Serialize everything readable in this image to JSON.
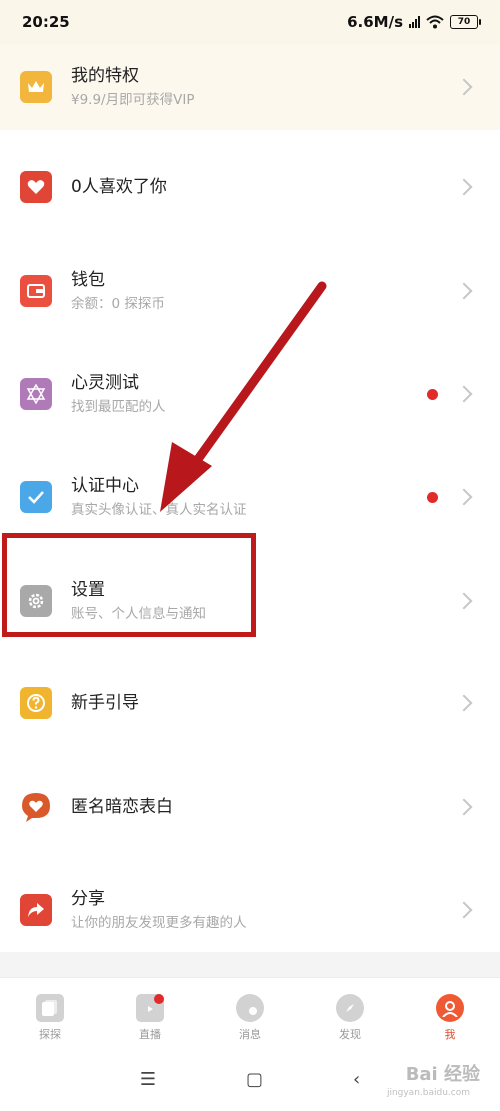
{
  "status_bar": {
    "time": "20:25",
    "speed": "6.6M/s",
    "battery": "70"
  },
  "menu": {
    "privilege": {
      "title": "我的特权",
      "subtitle": "¥9.9/月即可获得VIP"
    },
    "likes": {
      "title": "0人喜欢了你"
    },
    "wallet": {
      "title": "钱包",
      "subtitle": "余额：0 探探币"
    },
    "psych_test": {
      "title": "心灵测试",
      "subtitle": "找到最匹配的人"
    },
    "verify": {
      "title": "认证中心",
      "subtitle": "真实头像认证、真人实名认证"
    },
    "settings": {
      "title": "设置",
      "subtitle": "账号、个人信息与通知"
    },
    "guide": {
      "title": "新手引导"
    },
    "confession": {
      "title": "匿名暗恋表白"
    },
    "share": {
      "title": "分享",
      "subtitle": "让你的朋友发现更多有趣的人"
    }
  },
  "tabs": {
    "explore": "探探",
    "live": "直播",
    "messages": "消息",
    "discover": "发现",
    "me": "我"
  },
  "watermark": {
    "brand": "Bai 经验",
    "url": "jingyan.baidu.com"
  },
  "colors": {
    "highlight": "#c01b1b",
    "accent": "#e04d2d",
    "badge": "#e12a2a"
  },
  "icons": {
    "privilege": "crown-icon",
    "likes": "heart-icon",
    "wallet": "wallet-icon",
    "psych_test": "star-hexagram-icon",
    "verify": "checkmark-icon",
    "settings": "gear-icon",
    "guide": "question-icon",
    "confession": "heart-bubble-icon",
    "share": "share-arrow-icon"
  }
}
